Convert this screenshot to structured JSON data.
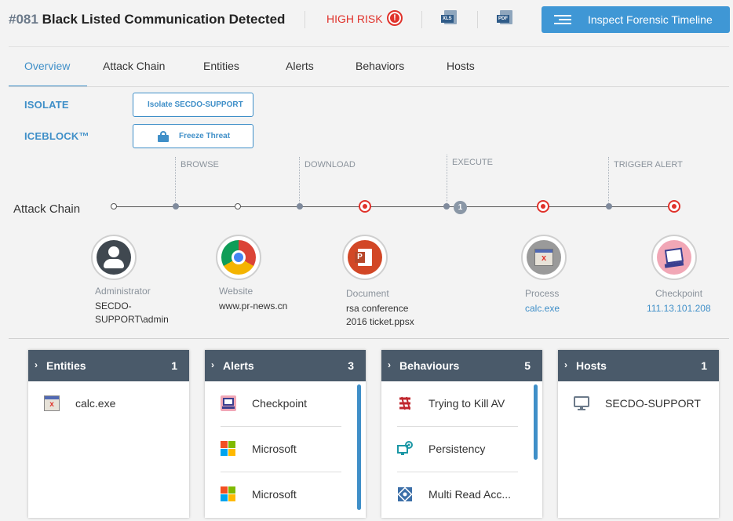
{
  "header": {
    "id": "#081",
    "title": "Black Listed Communication Detected",
    "risk_label": "HIGH RISK",
    "risk_icon": "!",
    "xls_label": "XLS",
    "pdf_label": "PDF",
    "inspect_label": "Inspect Forensic Timeline"
  },
  "tabs": [
    "Overview",
    "Attack Chain",
    "Entities",
    "Alerts",
    "Behaviors",
    "Hosts"
  ],
  "actions": {
    "isolate": {
      "label": "ISOLATE",
      "button": "Isolate SECDO-SUPPORT"
    },
    "iceblock": {
      "label": "ICEBLOCK™",
      "button": "Freeze Threat"
    }
  },
  "chain": {
    "title": "Attack Chain",
    "stages": [
      "BROWSE",
      "DOWNLOAD",
      "EXECUTE",
      "TRIGGER ALERT"
    ],
    "count_badge": "1",
    "entities": [
      {
        "type": "Administrator",
        "value": "SECDO-\nSUPPORT\\admin",
        "icon": "user-icon"
      },
      {
        "type": "Website",
        "value": "www.pr-news.cn",
        "icon": "chrome-icon"
      },
      {
        "type": "Document",
        "value": "rsa conference\n2016 ticket.ppsx",
        "icon": "powerpoint-icon"
      },
      {
        "type": "Process",
        "value": "calc.exe",
        "icon": "process-icon"
      },
      {
        "type": "Checkpoint",
        "value": "111.13.101.208",
        "icon": "checkpoint-icon"
      }
    ]
  },
  "panels": {
    "entities": {
      "title": "Entities",
      "count": "1",
      "items": [
        "calc.exe"
      ]
    },
    "alerts": {
      "title": "Alerts",
      "count": "3",
      "items": [
        "Checkpoint",
        "Microsoft",
        "Microsoft"
      ]
    },
    "behaviours": {
      "title": "Behaviours",
      "count": "5",
      "items": [
        "Trying to Kill AV",
        "Persistency",
        "Multi Read Acc..."
      ]
    },
    "hosts": {
      "title": "Hosts",
      "count": "1",
      "items": [
        "SECDO-SUPPORT"
      ]
    }
  },
  "colors": {
    "accent": "#3f8fc8",
    "risk": "#e0322b",
    "panel_header": "#4a5a6a"
  }
}
